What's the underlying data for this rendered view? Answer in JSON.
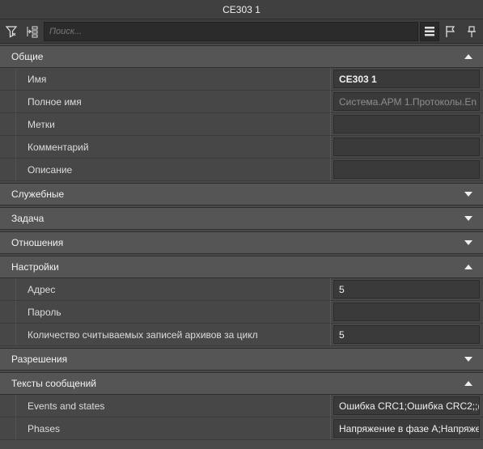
{
  "window": {
    "title": "CE303 1"
  },
  "toolbar": {
    "search_placeholder": "Поиск..."
  },
  "sections": {
    "general": {
      "title": "Общие",
      "rows": [
        {
          "label": "Имя",
          "value": "CE303 1"
        },
        {
          "label": "Полное имя",
          "value": "Система.АРМ 1.Протоколы.En"
        },
        {
          "label": "Метки",
          "value": ""
        },
        {
          "label": "Комментарий",
          "value": ""
        },
        {
          "label": "Описание",
          "value": ""
        }
      ]
    },
    "service": {
      "title": "Служебные"
    },
    "task": {
      "title": "Задача"
    },
    "relations": {
      "title": "Отношения"
    },
    "settings": {
      "title": "Настройки",
      "rows": [
        {
          "label": "Адрес",
          "value": "5"
        },
        {
          "label": "Пароль",
          "value": ""
        },
        {
          "label": "Количество считываемых записей архивов за цикл",
          "value": "5"
        }
      ]
    },
    "permissions": {
      "title": "Разрешения"
    },
    "messages": {
      "title": "Тексты сообщений",
      "rows": [
        {
          "label": "Events and states",
          "value": "Ошибка CRC1;Ошибка CRC2;;("
        },
        {
          "label": "Phases",
          "value": "Напряжение в фазе А;Напряже"
        }
      ]
    }
  }
}
